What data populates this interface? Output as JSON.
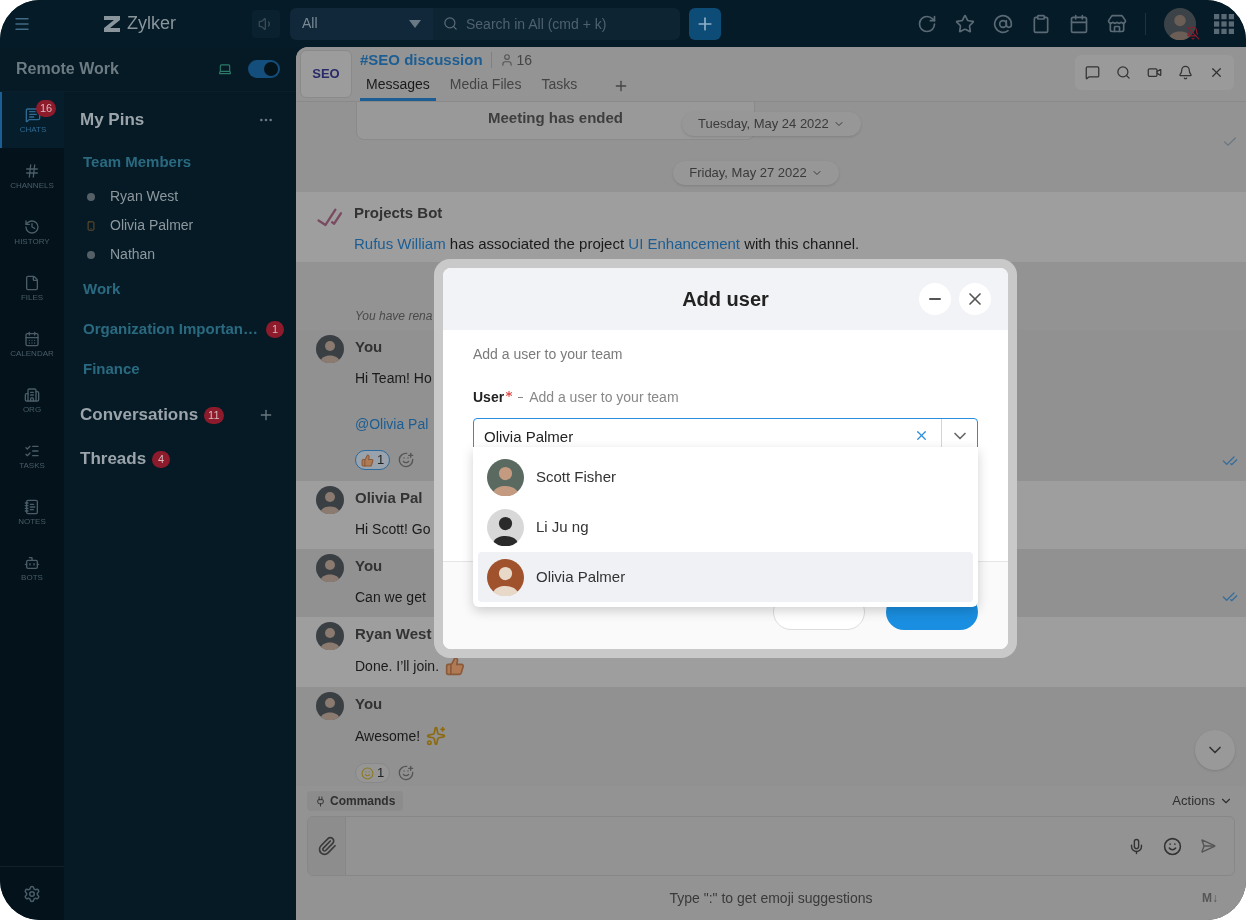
{
  "top_bar": {
    "app_name": "Zylker",
    "search_scope": "All",
    "search_placeholder": "Search in All (cmd + k)"
  },
  "rail": [
    {
      "kind": "chats",
      "label": "CHATS",
      "selected": true,
      "badge": "16"
    },
    {
      "kind": "channels",
      "label": "CHANNELS",
      "selected": false
    },
    {
      "kind": "history",
      "label": "HISTORY",
      "selected": false
    },
    {
      "kind": "files",
      "label": "FILES",
      "selected": false
    },
    {
      "kind": "calendar",
      "label": "CALENDAR",
      "selected": false
    },
    {
      "kind": "org",
      "label": "ORG",
      "selected": false
    },
    {
      "kind": "tasks",
      "label": "TASKS",
      "selected": false
    },
    {
      "kind": "notes",
      "label": "NOTES",
      "selected": false
    },
    {
      "kind": "bots",
      "label": "BOTS",
      "selected": false
    }
  ],
  "sidebar": {
    "workspace": "Remote Work",
    "status_on": true,
    "pins_title": "My Pins",
    "pin_groups": [
      {
        "label": "Team Members",
        "children": [
          {
            "name": "Ryan West",
            "kind": "dot"
          },
          {
            "name": "Olivia Palmer",
            "kind": "mobile"
          },
          {
            "name": "Nathan",
            "kind": "dot"
          }
        ]
      },
      {
        "label": "Work"
      },
      {
        "label": "Organization Importan…",
        "badge": "1"
      },
      {
        "label": "Finance"
      }
    ],
    "sections": [
      {
        "label": "Conversations",
        "badge": "11",
        "addable": true
      },
      {
        "label": "Threads",
        "badge": "4",
        "addable": false
      }
    ]
  },
  "channel": {
    "logo_text": "SEO",
    "name": "#SEO discussion",
    "member_count": "16",
    "tabs": [
      {
        "label": "Messages",
        "selected": true
      },
      {
        "label": "Media Files",
        "selected": false
      },
      {
        "label": "Tasks",
        "selected": false
      }
    ]
  },
  "messages": [
    {
      "kind": "meeting",
      "text": "Meeting has ended",
      "date": "Tuesday, May 24 2022",
      "receipt": {
        "kind": "sent"
      }
    },
    {
      "kind": "date",
      "label": "Friday, May 27 2022"
    },
    {
      "kind": "bot",
      "sender": "Projects Bot",
      "highlighted": true,
      "parts": [
        {
          "text": "Rufus William",
          "link": true
        },
        {
          "text": " has associated the project ",
          "link": false
        },
        {
          "text": "UI Enhancement",
          "link": true
        },
        {
          "text": " with this channel.",
          "link": false
        }
      ]
    },
    {
      "kind": "system",
      "text": "You have rena"
    },
    {
      "kind": "message",
      "sender": "You",
      "highlighted": false,
      "receipt": {
        "kind": "read"
      },
      "lines": [
        {
          "kind": "text",
          "text": "Hi Team! Ho"
        },
        {
          "kind": "mention",
          "text": "@Olivia Pal"
        }
      ],
      "reactions": [
        {
          "kind": "thumbs",
          "count": "1",
          "selected": true
        }
      ]
    },
    {
      "kind": "message",
      "sender": "Olivia Pal",
      "highlighted": true,
      "lines": [
        {
          "kind": "text",
          "text": "Hi Scott! Go"
        }
      ]
    },
    {
      "kind": "message",
      "sender": "You",
      "highlighted": false,
      "receipt": {
        "kind": "read"
      },
      "lines": [
        {
          "kind": "text",
          "text": "Can we get"
        }
      ]
    },
    {
      "kind": "message",
      "sender": "Ryan West",
      "highlighted": true,
      "lines": [
        {
          "kind": "text",
          "text": "Done. I’ll join.",
          "emoji": {
            "kind": "thumbs"
          }
        }
      ]
    },
    {
      "kind": "message",
      "sender": "You",
      "highlighted": false,
      "lines": [
        {
          "kind": "text",
          "text": "Awesome!",
          "emoji": {
            "kind": "fireworks"
          }
        }
      ],
      "reactions": [
        {
          "kind": "smile",
          "count": "1",
          "selected": false
        }
      ]
    }
  ],
  "composer": {
    "commands": "Commands",
    "actions": "Actions",
    "hint": "Type \":\" to get emoji suggestions",
    "markdown": "M↓"
  },
  "modal": {
    "title": "Add user",
    "subtitle": "Add a user to your team",
    "field_label": "User",
    "field_hint": "Add a user to your team",
    "value": "Olivia Palmer",
    "options": [
      {
        "name": "Scott Fisher",
        "selected": false
      },
      {
        "name": "Li Ju ng",
        "selected": false
      },
      {
        "name": "Olivia Palmer",
        "selected": true
      }
    ]
  }
}
